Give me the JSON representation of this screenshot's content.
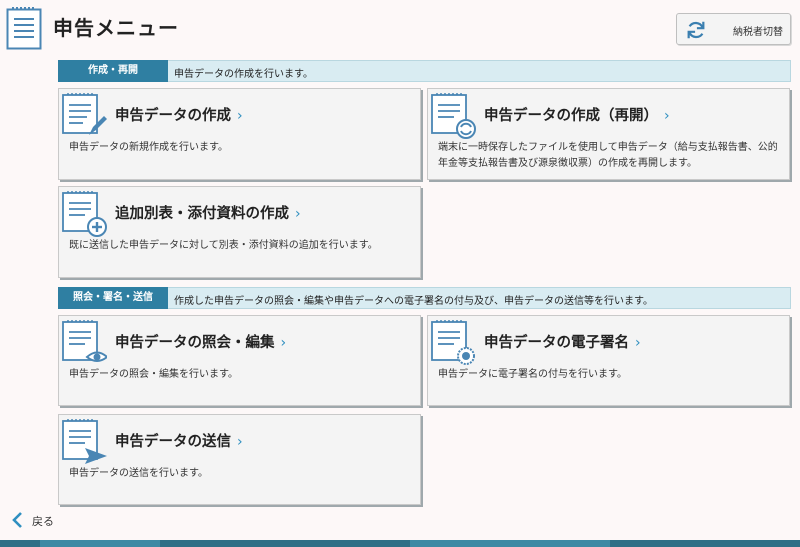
{
  "header": {
    "title": "申告メニュー",
    "switch_button": "納税者切替"
  },
  "sections": [
    {
      "tag": "作成・再開",
      "description": "申告データの作成を行います。"
    },
    {
      "tag": "照会・署名・送信",
      "description": "作成した申告データの照会・編集や申告データへの電子署名の付与及び、申告データの送信等を行います。"
    }
  ],
  "cards": {
    "create": {
      "title": "申告データの作成",
      "description": "申告データの新規作成を行います。",
      "icon": "pencil-icon"
    },
    "resume": {
      "title": "申告データの作成（再開）",
      "description": "端末に一時保存したファイルを使用して申告データ（給与支払報告書、公的年金等支払報告書及び源泉徴収票）の作成を再開します。",
      "icon": "refresh-icon"
    },
    "attach": {
      "title": "追加別表・添付資料の作成",
      "description": "既に送信した申告データに対して別表・添付資料の追加を行います。",
      "icon": "plus-circle-icon"
    },
    "view": {
      "title": "申告データの照会・編集",
      "description": "申告データの照会・編集を行います。",
      "icon": "eye-icon"
    },
    "sign": {
      "title": "申告データの電子署名",
      "description": "申告データに電子署名の付与を行います。",
      "icon": "seal-icon"
    },
    "send": {
      "title": "申告データの送信",
      "description": "申告データの送信を行います。",
      "icon": "send-icon"
    }
  },
  "footer": {
    "back_label": "戻る"
  },
  "colors": {
    "accent": "#2f7fa2",
    "section_bg": "#d9ecf2",
    "card_bg": "#f4f4f4",
    "icon_blue": "#4a86b4",
    "chevron": "#2f8fc0"
  }
}
